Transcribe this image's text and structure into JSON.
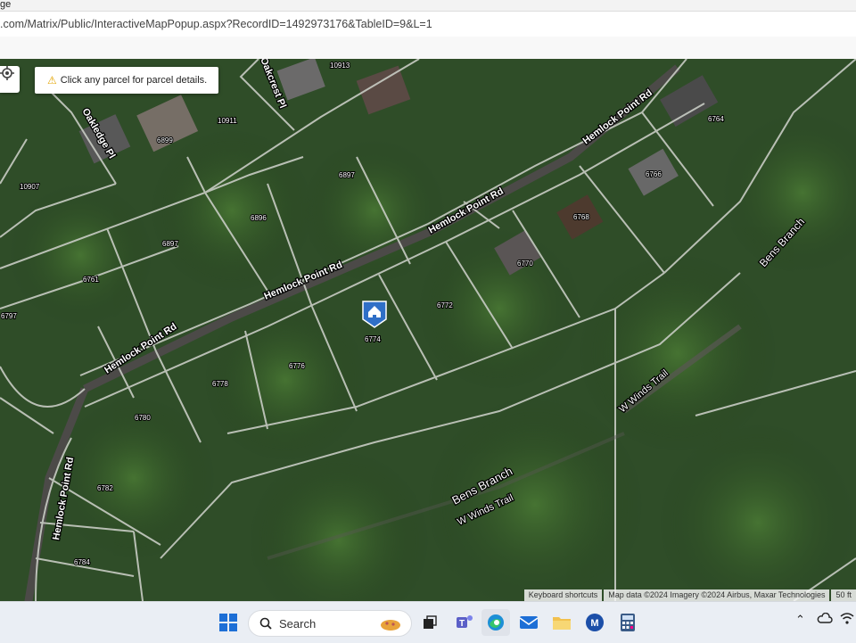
{
  "window": {
    "title_fragment": "ge"
  },
  "address_bar": {
    "url": ".com/Matrix/Public/InteractiveMapPopup.aspx?RecordID=1492973176&TableID=9&L=1"
  },
  "map": {
    "toast": {
      "message": "Click any parcel for parcel details.",
      "icon": "warning-icon"
    },
    "location_button_icon": "crosshair-icon",
    "roads": [
      {
        "id": "r1",
        "label": "Hemlock Point Rd"
      },
      {
        "id": "r2",
        "label": "Hemlock Point Rd"
      },
      {
        "id": "r3",
        "label": "Hemlock Point Rd"
      },
      {
        "id": "r4",
        "label": "Hemlock Point Rd"
      },
      {
        "id": "r5",
        "label": "Hemlock Point Rd"
      },
      {
        "id": "r6",
        "label": "Oakledge Pl"
      },
      {
        "id": "r7",
        "label": "Oakcrest Pl"
      },
      {
        "id": "r8",
        "label": "W Winds Trail"
      },
      {
        "id": "r9",
        "label": "W Winds Trail"
      },
      {
        "id": "r10",
        "label": "Bens Branch"
      },
      {
        "id": "r11",
        "label": "Bens Branch"
      }
    ],
    "parcels": [
      "10913",
      "10911",
      "6899",
      "10907",
      "6897",
      "6896",
      "6897",
      "6761",
      "6797",
      "6764",
      "6766",
      "6768",
      "6770",
      "6772",
      "6774",
      "6776",
      "6778",
      "6780",
      "6782",
      "6784"
    ],
    "marker_icon": "house-marker-icon",
    "attribution": {
      "shortcuts": "Keyboard shortcuts",
      "data": "Map data ©2024 Imagery ©2024 Airbus, Maxar Technologies",
      "scale": "50 ft"
    }
  },
  "taskbar": {
    "search_label": "Search",
    "items": [
      "windows-start-icon",
      "search-icon",
      "copilot-icon",
      "task-view-icon",
      "teams-icon",
      "edge-icon",
      "mail-icon",
      "file-explorer-icon",
      "mls-app-icon",
      "calculator-icon"
    ],
    "tray": [
      "chevron-up-icon",
      "cloud-icon",
      "wifi-icon"
    ]
  },
  "colors": {
    "accent": "#1a73e8",
    "marker": "#2f6fc7",
    "warning": "#e3a400",
    "parcel_line": "#c8ccc4"
  }
}
